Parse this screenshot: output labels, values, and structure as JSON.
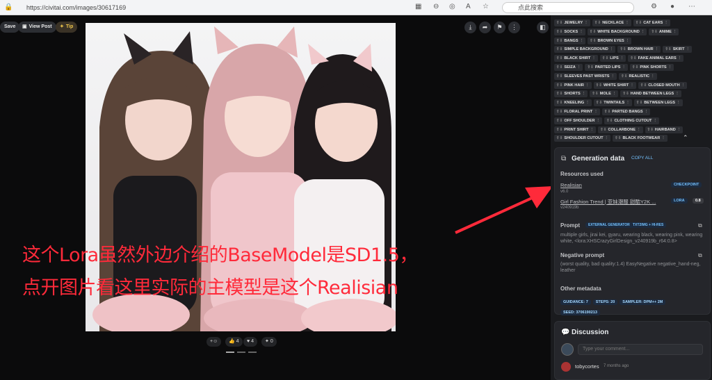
{
  "browser": {
    "url": "https://civitai.com/images/30617169",
    "search_placeholder": "点此搜索"
  },
  "viewer": {
    "save": "Save",
    "view_post": "View Post",
    "tip": "Tip",
    "reactions": {
      "add": "+☺",
      "like": "4",
      "heart": "4",
      "bolt": "0"
    }
  },
  "overlay": {
    "line1": "这个Lora虽然外边介绍的BaseModel是SD1.5，",
    "line2": "点开图片看这里实际的主模型是这个Realisian"
  },
  "tags": [
    [
      "JEWELRY",
      "NECKLACE",
      "CAT EARS"
    ],
    [
      "SOCKS",
      "WHITE BACKGROUND",
      "ANIME"
    ],
    [
      "BANGS",
      "BROWN EYES"
    ],
    [
      "SIMPLE BACKGROUND",
      "BROWN HAIR",
      "SKIRT"
    ],
    [
      "BLACK SHIRT",
      "LIPS",
      "FAKE ANIMAL EARS"
    ],
    [
      "SEIZA",
      "PARTED LIPS",
      "PINK SHORTS"
    ],
    [
      "SLEEVES PAST WRISTS",
      "REALISTIC"
    ],
    [
      "PINK HAIR",
      "WHITE SHIRT",
      "CLOSED MOUTH"
    ],
    [
      "SHORTS",
      "MOLE",
      "HAND BETWEEN LEGS"
    ],
    [
      "KNEELING",
      "TWINTAILS",
      "BETWEEN LEGS"
    ],
    [
      "FLORAL PRINT",
      "PARTED BANGS"
    ],
    [
      "OFF SHOULDER",
      "CLOTHING CUTOUT"
    ],
    [
      "PRINT SHIRT",
      "COLLARBONE",
      "HAIRBAND"
    ],
    [
      "SHOULDER CUTOUT",
      "BLACK FOOTWEAR"
    ]
  ],
  "gen": {
    "title": "Generation data",
    "copy": "COPY ALL",
    "resources": "Resources used",
    "r1_name": "Realisian",
    "r1_ver": "v6.0",
    "r1_badge": "CHECKPOINT",
    "r2_name": "Girl Fashion Trend | 亚妹潮服 甜酷Y2K ...",
    "r2_ver": "v240919b",
    "r2_badge": "LORA",
    "r2_weight": "0.8",
    "prompt_label": "Prompt",
    "prompt_tag1": "EXTERNAL GENERATOR",
    "prompt_tag2": "TXT2IMG + HI-RES",
    "prompt": "multiple girls, jirai kei, gyaru, wearing black, wearing pink, wearing white, <lora:XHSCrazyGirlDesign_v240919b_r64:0.8>",
    "neg_label": "Negative prompt",
    "neg": "(worst quality, bad quality:1.4) EasyNegative negative_hand-neg, leather",
    "other_label": "Other metadata",
    "m1": "GUIDANCE: 7",
    "m2": "STEPS: 20",
    "m3": "SAMPLER: DPM++ 2M",
    "m4": "SEED: 3706190213"
  },
  "discussion": {
    "title": "Discussion",
    "placeholder": "Type your comment...",
    "user": "tobycortes",
    "time": "7 months ago"
  },
  "colors": {
    "accent": "#74c0fc",
    "overlay_red": "#ff2a3a"
  }
}
